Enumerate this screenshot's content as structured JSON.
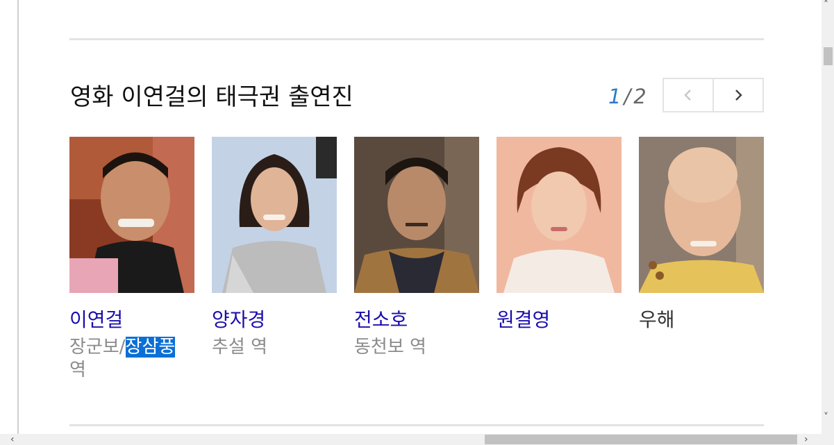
{
  "section": {
    "title": "영화 이연걸의 태극권 출연진"
  },
  "pager": {
    "current": "1",
    "separator": "/",
    "total": "2"
  },
  "cast": [
    {
      "name": "이연걸",
      "role_pre": "장군보/",
      "role_highlight": "장삼풍",
      "role_post": "역"
    },
    {
      "name": "양자경",
      "role": "추설 역"
    },
    {
      "name": "전소호",
      "role": "동천보 역"
    },
    {
      "name": "원결영",
      "role": ""
    },
    {
      "name": "우해",
      "role": ""
    }
  ]
}
